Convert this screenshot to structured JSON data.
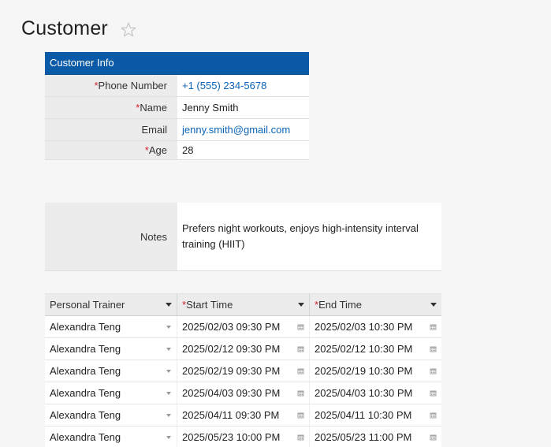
{
  "page": {
    "title": "Customer"
  },
  "info": {
    "header": "Customer Info",
    "fields": [
      {
        "label": "Phone Number",
        "required": "*",
        "value": "+1 (555) 234-5678"
      },
      {
        "label": "Name",
        "required": "*",
        "value": "Jenny Smith"
      },
      {
        "label": "Email",
        "required": "",
        "value": "jenny.smith@gmail.com"
      },
      {
        "label": "Age",
        "required": "*",
        "value": "28"
      }
    ]
  },
  "notes": {
    "label": "Notes",
    "value": "Prefers night workouts, enjoys high-intensity interval training (HIIT)"
  },
  "sessions": {
    "columns": [
      {
        "label": "Personal Trainer",
        "required": ""
      },
      {
        "label": "Start Time",
        "required": "*"
      },
      {
        "label": "End Time",
        "required": "*"
      }
    ],
    "rows": [
      {
        "trainer": "Alexandra Teng",
        "start": "2025/02/03 09:30 PM",
        "end": "2025/02/03 10:30 PM"
      },
      {
        "trainer": "Alexandra Teng",
        "start": "2025/02/12 09:30 PM",
        "end": "2025/02/12 10:30 PM"
      },
      {
        "trainer": "Alexandra Teng",
        "start": "2025/02/19 09:30 PM",
        "end": "2025/02/19 10:30 PM"
      },
      {
        "trainer": "Alexandra Teng",
        "start": "2025/04/03 09:30 PM",
        "end": "2025/04/03 10:30 PM"
      },
      {
        "trainer": "Alexandra Teng",
        "start": "2025/04/11 09:30 PM",
        "end": "2025/04/11 10:30 PM"
      },
      {
        "trainer": "Alexandra Teng",
        "start": "2025/05/23 10:00 PM",
        "end": "2025/05/23 11:00 PM"
      }
    ]
  },
  "colors": {
    "header_blue": "#0b5aa8",
    "link_blue": "#0b63b8",
    "required_red": "#d0202a"
  },
  "icons": {
    "favorite": "star-outline-icon",
    "dropdown": "chevron-down-icon",
    "date_picker": "calendar-icon"
  }
}
